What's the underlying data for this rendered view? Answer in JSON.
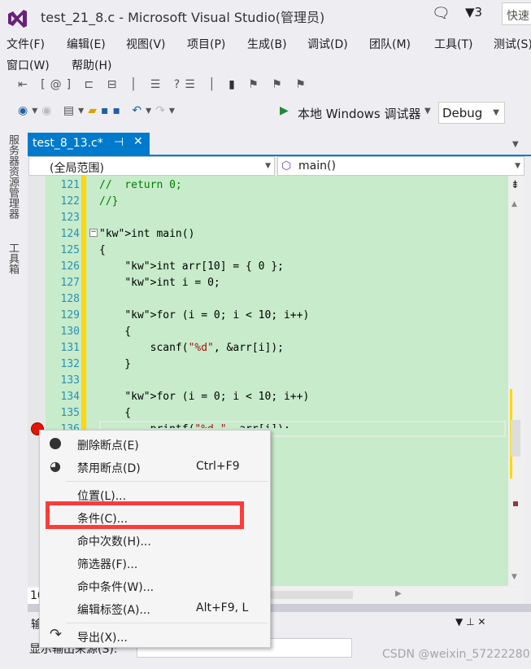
{
  "window": {
    "title": "test_21_8.c - Microsoft Visual Studio(管理员)",
    "notification_count": "3",
    "quick_launch": "快速"
  },
  "menu": [
    "文件(F)",
    "编辑(E)",
    "视图(V)",
    "项目(P)",
    "生成(B)",
    "调试(D)",
    "团队(M)",
    "工具(T)",
    "测试(S)",
    "窗口(W)",
    "帮助(H)"
  ],
  "toolbar": {
    "debugger": "本地 Windows 调试器",
    "config": "Debug"
  },
  "tab": {
    "label": "test_8_13.c*"
  },
  "nav": {
    "scope": "(全局范围)",
    "member": "main()"
  },
  "side_tabs": [
    "服务器资源管理器",
    "工具箱"
  ],
  "code": [
    {
      "n": "121",
      "t": "//  return 0;",
      "c": "cm"
    },
    {
      "n": "122",
      "t": "//}",
      "c": "cm"
    },
    {
      "n": "123",
      "t": "",
      "c": ""
    },
    {
      "n": "124",
      "t": "int main()",
      "c": "fn"
    },
    {
      "n": "125",
      "t": "{",
      "c": ""
    },
    {
      "n": "126",
      "t": "    int arr[10] = { 0 };",
      "c": "kw"
    },
    {
      "n": "127",
      "t": "    int i = 0;",
      "c": "kw"
    },
    {
      "n": "128",
      "t": "",
      "c": ""
    },
    {
      "n": "129",
      "t": "    for (i = 0; i < 10; i++)",
      "c": "kw"
    },
    {
      "n": "130",
      "t": "    {",
      "c": ""
    },
    {
      "n": "131",
      "t": "        scanf(\"%d\", &arr[i]);",
      "c": "sc"
    },
    {
      "n": "132",
      "t": "    }",
      "c": ""
    },
    {
      "n": "133",
      "t": "",
      "c": ""
    },
    {
      "n": "134",
      "t": "    for (i = 0; i < 10; i++)",
      "c": "kw"
    },
    {
      "n": "135",
      "t": "    {",
      "c": ""
    },
    {
      "n": "136",
      "t": "        printf(\"%d \", arr[i]);",
      "c": "pr"
    }
  ],
  "context_menu": [
    {
      "label": "删除断点(E)",
      "shortcut": "",
      "icon": "breakpoint-icon"
    },
    {
      "label": "禁用断点(D)",
      "shortcut": "Ctrl+F9",
      "icon": "disable-breakpoint-icon"
    },
    {
      "sep": true
    },
    {
      "label": "位置(L)...",
      "shortcut": ""
    },
    {
      "label": "条件(C)...",
      "shortcut": "",
      "highlighted": true
    },
    {
      "label": "命中次数(H)...",
      "shortcut": ""
    },
    {
      "label": "筛选器(F)...",
      "shortcut": ""
    },
    {
      "label": "命中条件(W)...",
      "shortcut": ""
    },
    {
      "label": "编辑标签(A)...",
      "shortcut": "Alt+F9, L"
    },
    {
      "sep": true
    },
    {
      "label": "导出(X)...",
      "shortcut": "",
      "icon": "export-icon"
    }
  ],
  "zoom": "10",
  "output": {
    "title": "输",
    "source_label": "显示输出来源(S):"
  },
  "watermark": "CSDN @weixin_57222280",
  "colors": {
    "highlight_box": "#ff3b3b",
    "accent": "#007acc",
    "code_bg": "#c7ebcb",
    "breakpoint": "#e51400"
  }
}
